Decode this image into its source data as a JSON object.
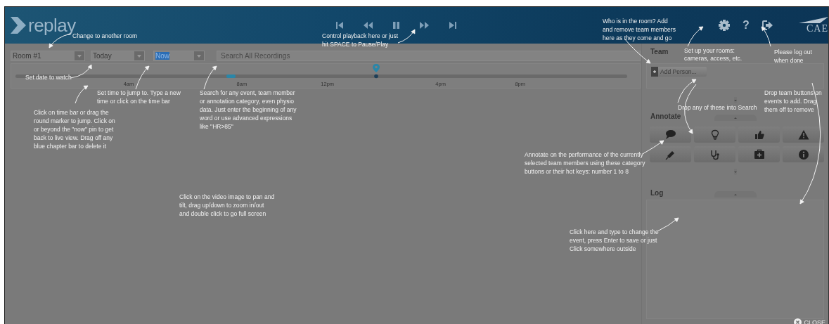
{
  "header": {
    "logo": "replay",
    "playback": [
      {
        "kind": "skip-back"
      },
      {
        "kind": "rewind"
      },
      {
        "kind": "pause"
      },
      {
        "kind": "fast-forward"
      },
      {
        "kind": "skip-forward"
      }
    ],
    "tools": [
      {
        "kind": "settings"
      },
      {
        "kind": "help",
        "label": "?"
      },
      {
        "kind": "logout"
      }
    ],
    "brand": "CAE"
  },
  "room": {
    "value": "Room #1"
  },
  "date": {
    "value": "Today"
  },
  "time": {
    "value": "Now",
    "selected": true
  },
  "search": {
    "placeholder": "Search All Recordings"
  },
  "timeline": {
    "level": 0.59,
    "ticks": [
      "4am",
      "8am",
      "12pm",
      "4pm",
      "8pm"
    ]
  },
  "team": {
    "title": "Team",
    "add_button": "Add Person..."
  },
  "annotate": {
    "title": "Annotate",
    "buttons": [
      {
        "kind": "comment"
      },
      {
        "kind": "lightbulb"
      },
      {
        "kind": "thumbs-up"
      },
      {
        "kind": "warning"
      },
      {
        "kind": "syringe"
      },
      {
        "kind": "stethoscope"
      },
      {
        "kind": "medkit"
      },
      {
        "kind": "info"
      }
    ]
  },
  "log": {
    "title": "Log"
  },
  "close_button": "CLOSE",
  "help_notes": [
    {
      "text": "Change to another room"
    },
    {
      "text": "Control playback here or just hit SPACE to Pause/Play"
    },
    {
      "text": "Who is in the room? Add and remove team members here as they come and go"
    },
    {
      "text": "Set up your rooms: cameras, access, etc."
    },
    {
      "text": "Please log out when done"
    },
    {
      "text": "Set date to watch"
    },
    {
      "text": "Set time to jump to. Type a new time or click on the time bar"
    },
    {
      "text": "Search for any event, team member or annotation category, even physio data. Just enter the beginning of any word or use advanced expressions like \"HR>85\""
    },
    {
      "text": "Click on time bar or drag the round marker to jump. Click on or beyond the \"now\" pin to get back to live view. Drag off any blue chapter bar to delete it"
    },
    {
      "text": "Click on the video image to pan and tilt, drag up/down to zoom in/out and double click to go full screen"
    },
    {
      "text": "Drop any of these into Search"
    },
    {
      "text": "Drop team buttons on events to add. Drag them off to remove"
    },
    {
      "text": "Annotate on the performance of the currently selected team members using these category buttons or their hot keys: number 1 to 8"
    },
    {
      "text": "Click here and type to change the event, press Enter to save or just Click somewhere outside"
    }
  ]
}
